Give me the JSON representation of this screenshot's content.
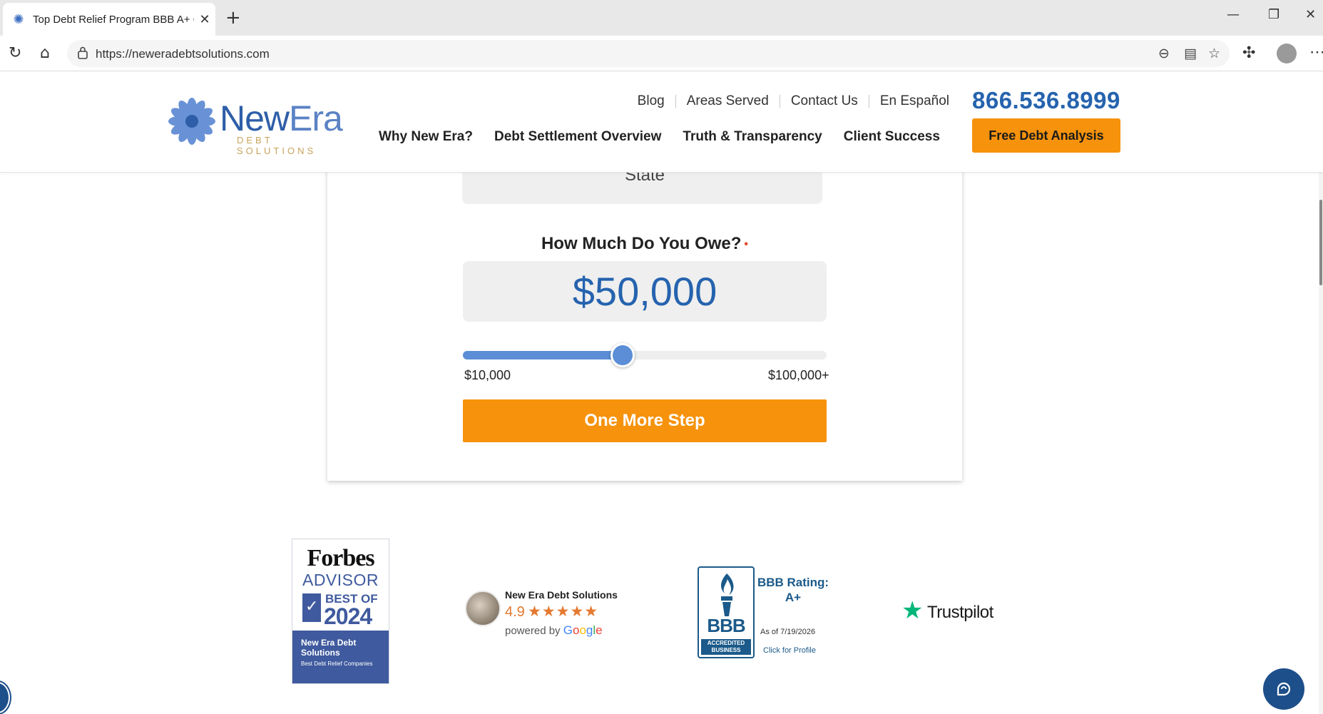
{
  "browser": {
    "tab_title": "Top Debt Relief Program BBB A+ C",
    "url": "https://neweradebtsolutions.com"
  },
  "site": {
    "logo": {
      "name_part1": "New",
      "name_part2": "Era",
      "subtitle": "DEBT SOLUTIONS"
    },
    "top_links": [
      "Blog",
      "Areas Served",
      "Contact Us",
      "En Español"
    ],
    "phone": "866.536.8999",
    "main_nav": [
      "Why New Era?",
      "Debt Settlement Overview",
      "Truth & Transparency",
      "Client Success"
    ],
    "cta_label": "Free Debt Analysis"
  },
  "form": {
    "state_placeholder": "State",
    "owe_label": "How Much Do You Owe?",
    "required_mark": "•",
    "amount": "$50,000",
    "slider": {
      "min_label": "$10,000",
      "max_label": "$100,000+",
      "fraction": 0.44
    },
    "submit_label": "One More Step"
  },
  "badges": {
    "forbes": {
      "brand": "Forbes",
      "advisor": "ADVISOR",
      "best_of": "BEST OF",
      "year": "2024",
      "company": "New Era Debt Solutions",
      "category": "Best Debt Relief Companies"
    },
    "google": {
      "name": "New Era Debt Solutions",
      "score": "4.9",
      "stars": "★★★★★",
      "powered_by": "powered by",
      "google": "Google"
    },
    "bbb": {
      "letters": "BBB",
      "accredited": "ACCREDITED BUSINESS",
      "rating_label": "BBB Rating: A+",
      "as_of": "As of 7/19/2026",
      "click": "Click for Profile"
    },
    "trustpilot": {
      "name": "Trustpilot"
    }
  },
  "colors": {
    "brand_blue": "#2563ae",
    "accent_orange": "#f6920c",
    "forbes_blue": "#3f5a9e",
    "bbb_blue": "#1b5a8a",
    "trustpilot_green": "#00b67a"
  },
  "icons": [
    "tab-favicon-icon",
    "close-icon",
    "plus-icon",
    "minimize-icon",
    "restore-icon",
    "window-close-icon",
    "reload-icon",
    "home-icon",
    "lock-icon",
    "zoom-out-icon",
    "reader-icon",
    "favorite-icon",
    "extensions-icon",
    "profile-icon",
    "more-icon",
    "chat-icon",
    "accessibility-icon"
  ]
}
